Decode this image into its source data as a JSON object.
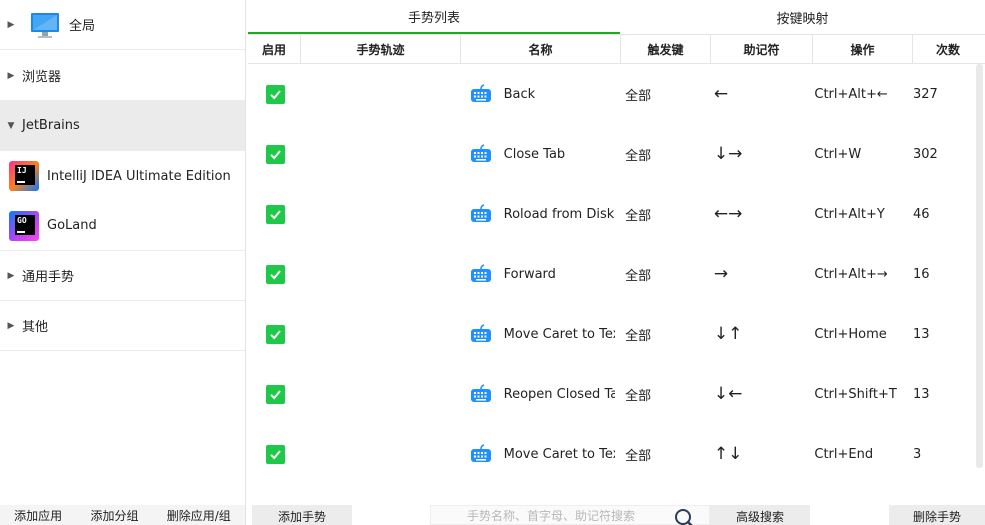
{
  "sidebar": {
    "groups": [
      {
        "label": "全局",
        "expanded": false
      },
      {
        "label": "浏览器",
        "expanded": false
      },
      {
        "label": "JetBrains",
        "expanded": true,
        "selected": true
      },
      {
        "label": "通用手势",
        "expanded": false
      },
      {
        "label": "其他",
        "expanded": false
      }
    ],
    "apps": [
      {
        "label": "IntelliJ IDEA Ultimate Edition",
        "icon_text": "IJ"
      },
      {
        "label": "GoLand",
        "icon_text": "GO"
      }
    ],
    "bottom_buttons": [
      "添加应用",
      "添加分组",
      "删除应用/组"
    ]
  },
  "tabs": [
    {
      "label": "手势列表",
      "active": true
    },
    {
      "label": "按键映射",
      "active": false
    }
  ],
  "table": {
    "headers": [
      "启用",
      "手势轨迹",
      "名称",
      "触发键",
      "助记符",
      "操作",
      "次数"
    ],
    "rows": [
      {
        "enabled": true,
        "name": "Back",
        "trigger": "全部",
        "mnemonic": "←",
        "action": "Ctrl+Alt+←",
        "count": "327"
      },
      {
        "enabled": true,
        "name": "Close Tab",
        "trigger": "全部",
        "mnemonic": "↓→",
        "action": "Ctrl+W",
        "count": "302"
      },
      {
        "enabled": true,
        "name": "Roload from Disk",
        "trigger": "全部",
        "mnemonic": "←→",
        "action": "Ctrl+Alt+Y",
        "count": "46"
      },
      {
        "enabled": true,
        "name": "Forward",
        "trigger": "全部",
        "mnemonic": "→",
        "action": "Ctrl+Alt+→",
        "count": "16"
      },
      {
        "enabled": true,
        "name": "Move Caret to Text Start",
        "trigger": "全部",
        "mnemonic": "↓↑",
        "action": "Ctrl+Home",
        "count": "13"
      },
      {
        "enabled": true,
        "name": "Reopen Closed Tab",
        "trigger": "全部",
        "mnemonic": "↓←",
        "action": "Ctrl+Shift+T",
        "count": "13"
      },
      {
        "enabled": true,
        "name": "Move Caret to Text End",
        "trigger": "全部",
        "mnemonic": "↑↓",
        "action": "Ctrl+End",
        "count": "3"
      }
    ]
  },
  "bottom": {
    "add_gesture": "添加手势",
    "search_placeholder": "手势名称、首字母、助记符搜索",
    "advanced_search": "高级搜索",
    "delete_gesture": "删除手势"
  },
  "colors": {
    "accent": "#1aad19",
    "checkbox": "#1ec94a",
    "keyboard_icon": "#1e90ff"
  },
  "icons": [
    "monitor-icon",
    "intellij-idea-icon",
    "goland-icon",
    "keyboard-icon",
    "search-icon",
    "checkmark-icon"
  ]
}
